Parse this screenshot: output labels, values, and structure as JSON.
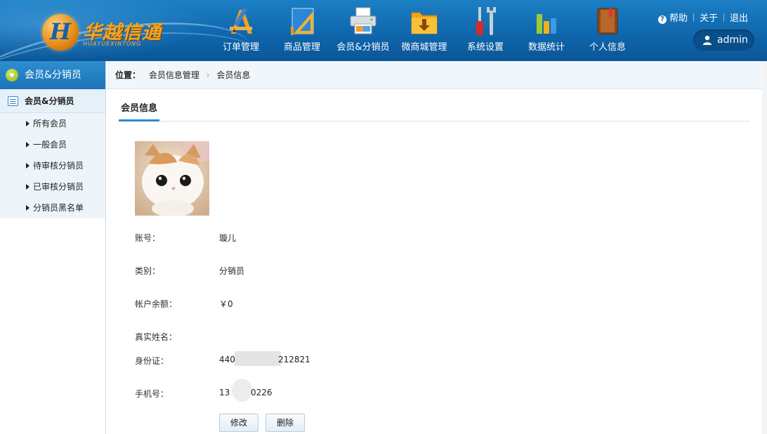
{
  "brand": {
    "name": "华越信通",
    "subtitle": "HUAYUEXINTONG",
    "mark": "H"
  },
  "nav": [
    {
      "label": "订单管理",
      "icon": "order-tools-icon"
    },
    {
      "label": "商品管理",
      "icon": "ruler-triangle-icon"
    },
    {
      "label": "会员&分销员",
      "icon": "printer-icon"
    },
    {
      "label": "微商城管理",
      "icon": "folder-download-icon"
    },
    {
      "label": "系统设置",
      "icon": "wrench-screwdriver-icon"
    },
    {
      "label": "数据统计",
      "icon": "bar-chart-icon"
    },
    {
      "label": "个人信息",
      "icon": "book-icon"
    }
  ],
  "toplinks": {
    "help": "帮助",
    "about": "关于",
    "logout": "退出"
  },
  "user": {
    "name": "admin"
  },
  "sidebar": {
    "header": "会员&分销员",
    "group": "会员&分销员",
    "items": [
      {
        "label": "所有会员"
      },
      {
        "label": "一般会员"
      },
      {
        "label": "待审核分销员"
      },
      {
        "label": "已审核分销员"
      },
      {
        "label": "分销员黑名单"
      }
    ]
  },
  "breadcrumb": {
    "prefix": "位置：",
    "level1": "会员信息管理",
    "separator": "›",
    "level2": "会员信息"
  },
  "tab": {
    "label": "会员信息"
  },
  "member": {
    "account_label": "账号：",
    "account": "璇儿",
    "category_label": "类别：",
    "category": "分销员",
    "balance_label": "帐户余额：",
    "balance": "￥0",
    "realname_label": "真实姓名：",
    "realname": "",
    "idcard_label": "身份证：",
    "idcard_prefix": "440",
    "idcard_suffix": "212821",
    "phone_label": "手机号：",
    "phone_prefix": "13",
    "phone_suffix": "0226"
  },
  "buttons": {
    "edit": "修改",
    "delete": "删除"
  },
  "colors": {
    "header": "#0f67ad",
    "accent": "#2a8ad6",
    "logo": "#f7a520"
  }
}
